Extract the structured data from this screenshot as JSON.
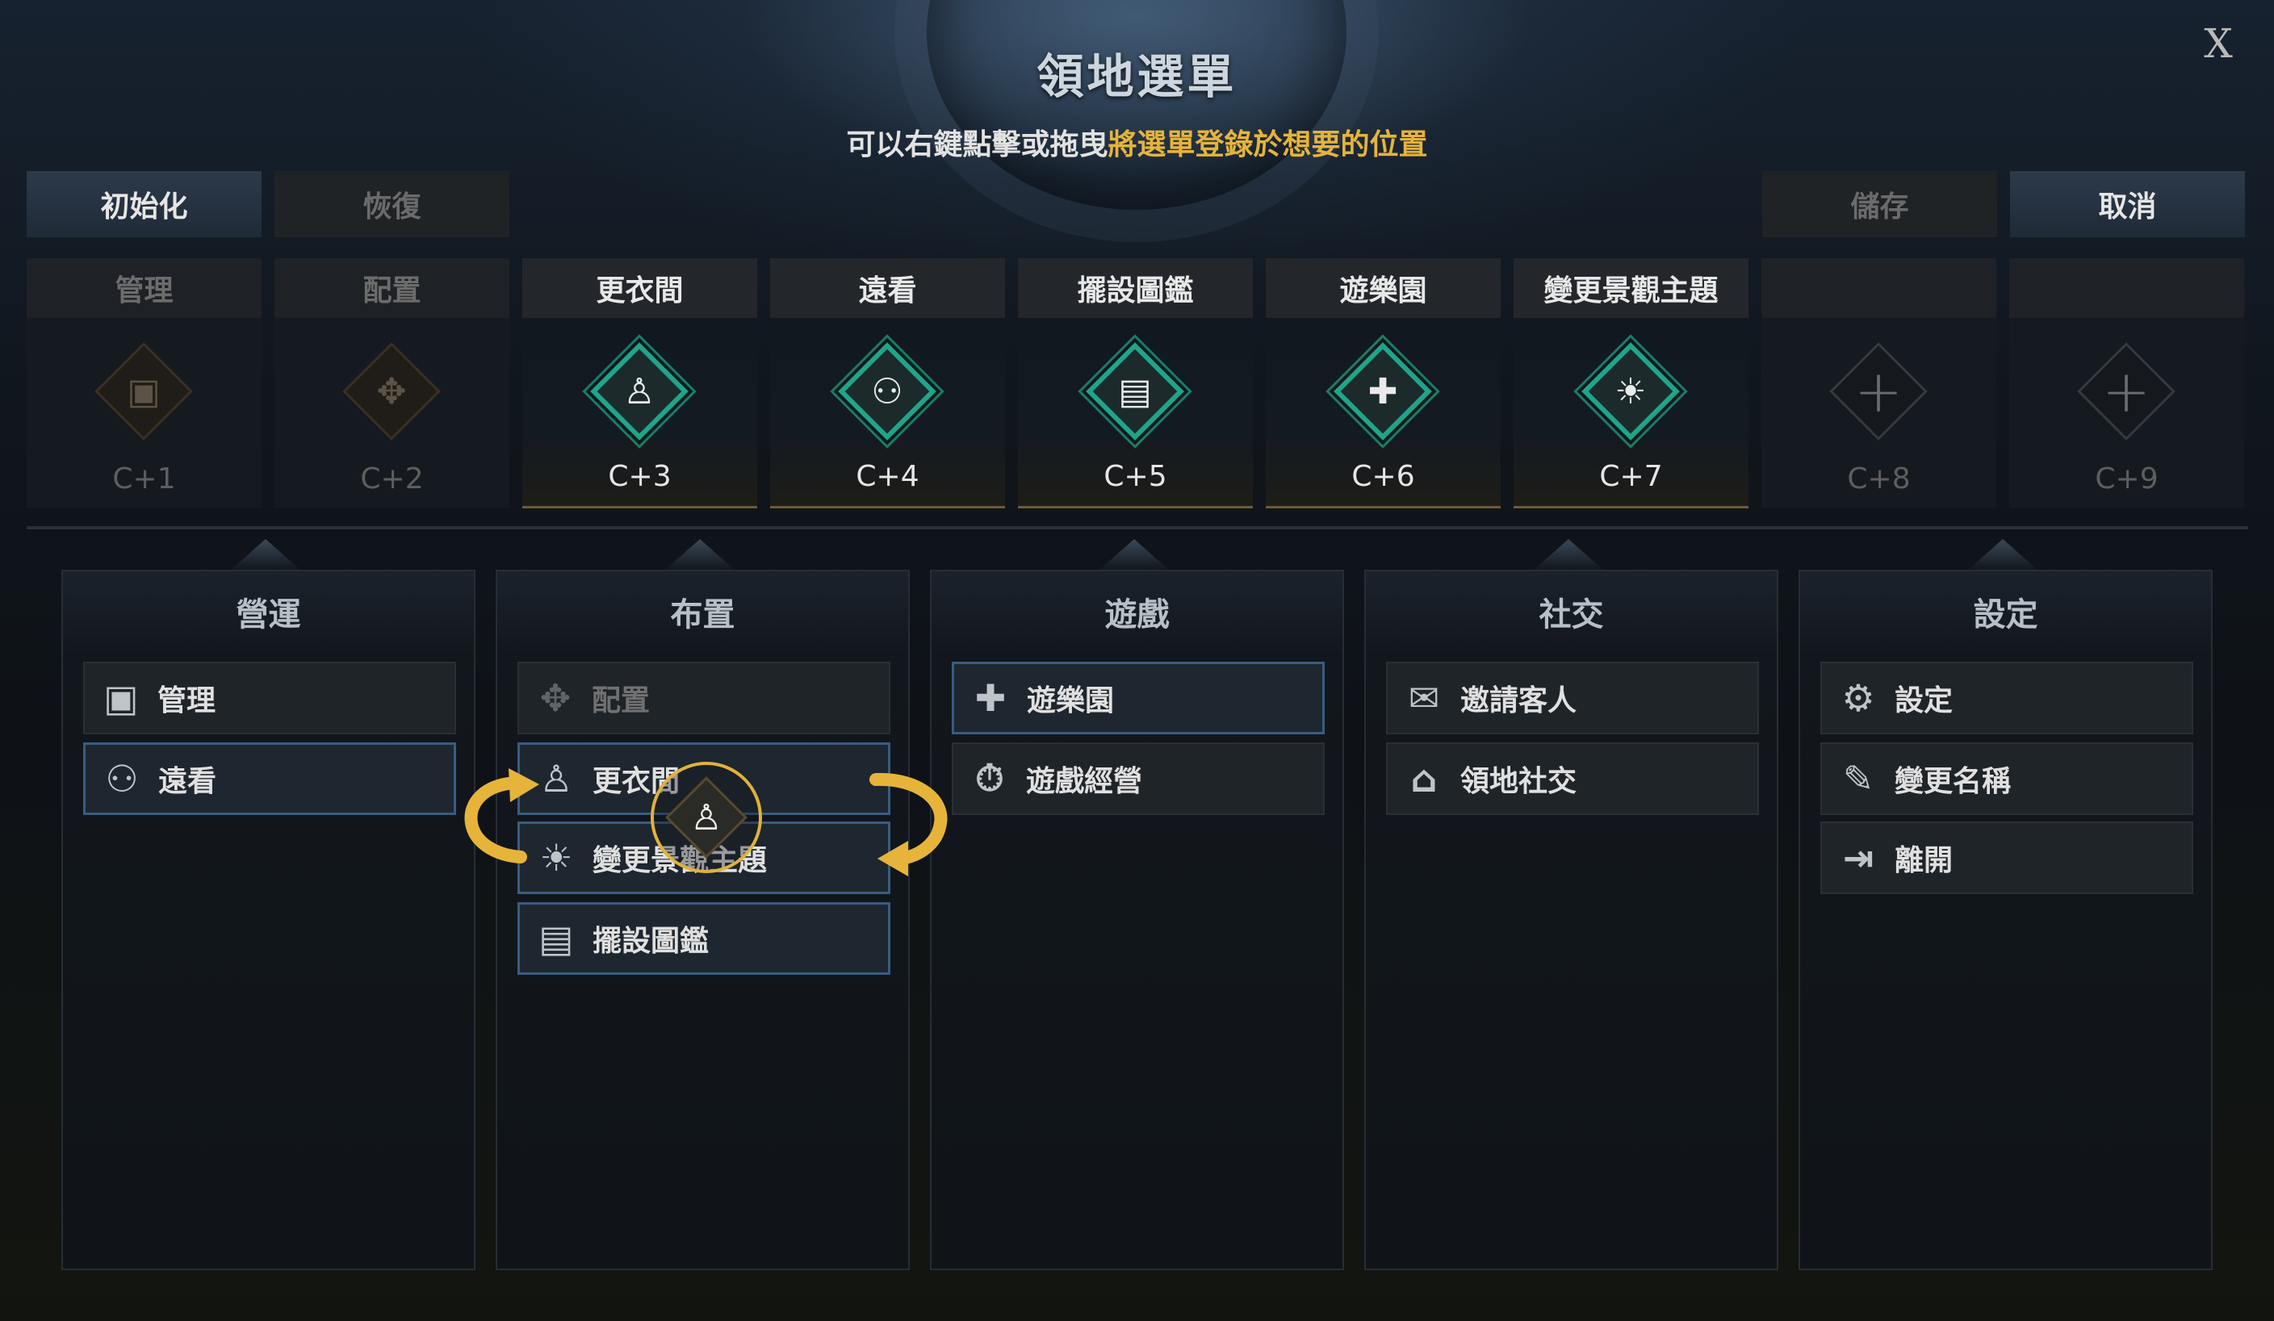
{
  "header": {
    "title": "領地選單",
    "subtitle_plain": "可以右鍵點擊或拖曳",
    "subtitle_highlight": "將選單登錄於想要的位置",
    "close_label": "X"
  },
  "buttons": {
    "reset": "初始化",
    "restore": "恢復",
    "save": "儲存",
    "cancel": "取消"
  },
  "slots": [
    {
      "title": "管理",
      "key": "C+1",
      "icon": "clipboard-icon",
      "glyph": "▣"
    },
    {
      "title": "配置",
      "key": "C+2",
      "icon": "move-arrows-icon",
      "glyph": "✥"
    },
    {
      "title": "更衣間",
      "key": "C+3",
      "icon": "suit-icon",
      "glyph": "♙"
    },
    {
      "title": "遠看",
      "key": "C+4",
      "icon": "binoculars-icon",
      "glyph": "⚇"
    },
    {
      "title": "擺設圖鑑",
      "key": "C+5",
      "icon": "armchair-book-icon",
      "glyph": "▤"
    },
    {
      "title": "遊樂園",
      "key": "C+6",
      "icon": "gamepad-icon",
      "glyph": "✚"
    },
    {
      "title": "變更景觀主題",
      "key": "C+7",
      "icon": "sun-cloud-icon",
      "glyph": "☀"
    },
    {
      "title": "",
      "key": "C+8",
      "icon": "plus-icon",
      "glyph": "+"
    },
    {
      "title": "",
      "key": "C+9",
      "icon": "plus-icon",
      "glyph": "+"
    }
  ],
  "categories": [
    {
      "title": "營運",
      "items": [
        {
          "label": "管理",
          "icon": "clipboard-icon",
          "glyph": "▣"
        },
        {
          "label": "遠看",
          "icon": "binoculars-icon",
          "glyph": "⚇"
        }
      ]
    },
    {
      "title": "布置",
      "items": [
        {
          "label": "配置",
          "icon": "move-arrows-icon",
          "glyph": "✥"
        },
        {
          "label": "更衣間",
          "icon": "suit-icon",
          "glyph": "♙"
        },
        {
          "label": "變更景觀主題",
          "icon": "sun-cloud-icon",
          "glyph": "☀"
        },
        {
          "label": "擺設圖鑑",
          "icon": "armchair-book-icon",
          "glyph": "▤"
        }
      ]
    },
    {
      "title": "遊戲",
      "items": [
        {
          "label": "遊樂園",
          "icon": "gamepad-icon",
          "glyph": "✚"
        },
        {
          "label": "遊戲經營",
          "icon": "timer-gear-icon",
          "glyph": "⏱"
        }
      ]
    },
    {
      "title": "社交",
      "items": [
        {
          "label": "邀請客人",
          "icon": "invite-guest-icon",
          "glyph": "✉"
        },
        {
          "label": "領地社交",
          "icon": "house-icon",
          "glyph": "⌂"
        }
      ]
    },
    {
      "title": "設定",
      "items": [
        {
          "label": "設定",
          "icon": "gear-icon",
          "glyph": "⚙"
        },
        {
          "label": "變更名稱",
          "icon": "edit-icon",
          "glyph": "✎"
        },
        {
          "label": "離開",
          "icon": "exit-door-icon",
          "glyph": "⇥"
        }
      ]
    }
  ],
  "drag_ghost": {
    "icon": "suit-icon",
    "glyph": "♙"
  },
  "colors": {
    "accent_gold": "#e6b43a",
    "slot_green": "#1fa58a",
    "selected_border": "#3a5c82"
  }
}
